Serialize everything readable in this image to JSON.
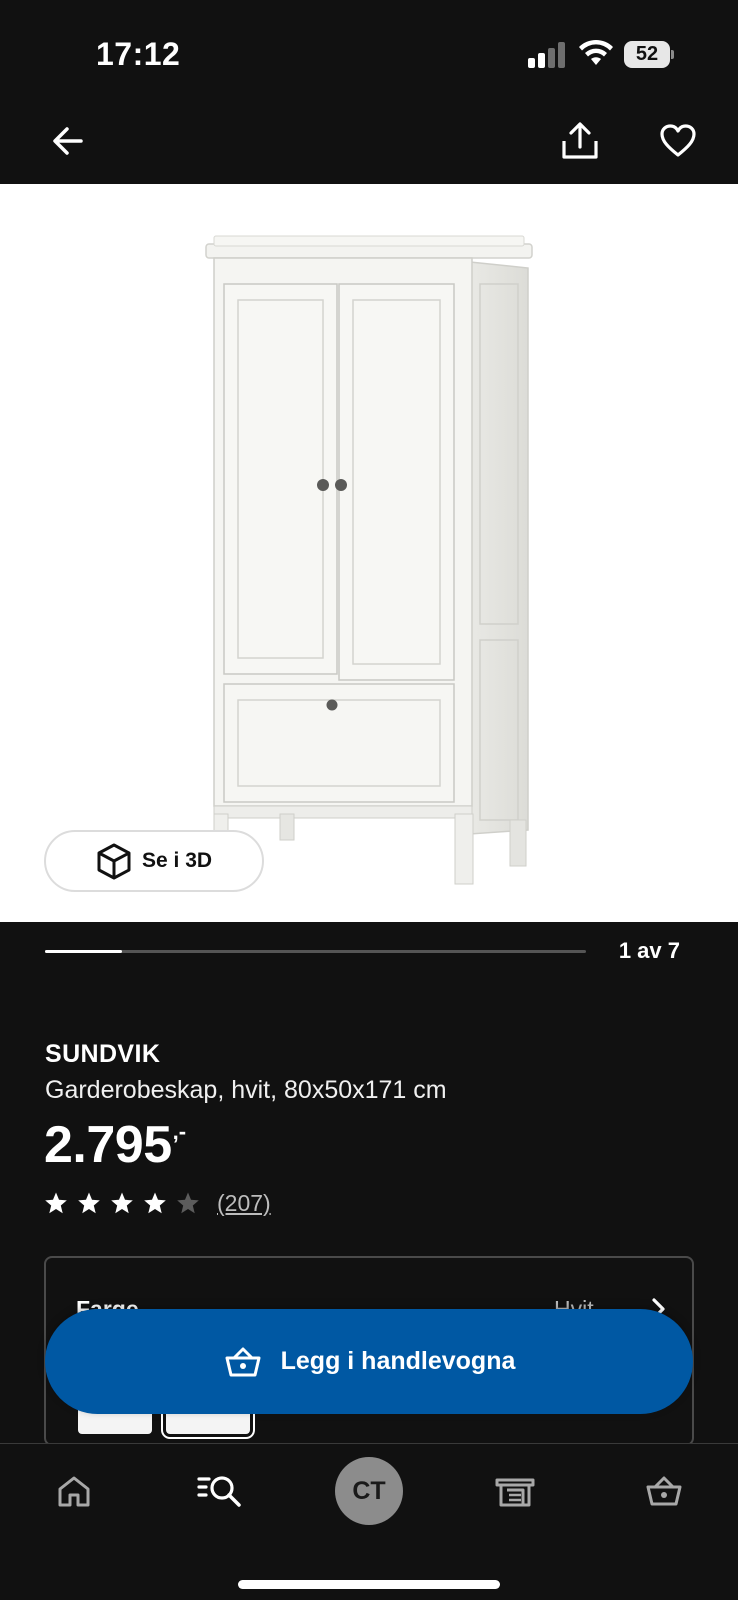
{
  "status_bar": {
    "time": "17:12",
    "battery": "52"
  },
  "top_nav": {
    "back_icon": "arrow-left-icon",
    "share_icon": "share-icon",
    "favorite_icon": "heart-icon"
  },
  "gallery": {
    "view_3d_label": "Se i 3D",
    "view_3d_icon": "cube-icon",
    "pager_text": "1 av 7",
    "current_index": 1,
    "total": 7
  },
  "product": {
    "name": "SUNDVIK",
    "description": "Garderobeskap, hvit, 80x50x171 cm",
    "price_main": "2.795",
    "price_suffix": ",-",
    "rating_stars": 4,
    "rating_max": 5,
    "review_count": "(207)"
  },
  "color_selector": {
    "label": "Farge",
    "value": "Hvit"
  },
  "add_to_cart": {
    "label": "Legg i handlevogna",
    "icon": "basket-icon"
  },
  "tab_bar": {
    "items": [
      "home-icon",
      "search-icon",
      "profile-avatar",
      "store-icon",
      "basket-icon"
    ],
    "avatar_initials": "CT"
  },
  "colors": {
    "background": "#111111",
    "accent": "#0058a3",
    "image_bg": "#ffffff"
  }
}
